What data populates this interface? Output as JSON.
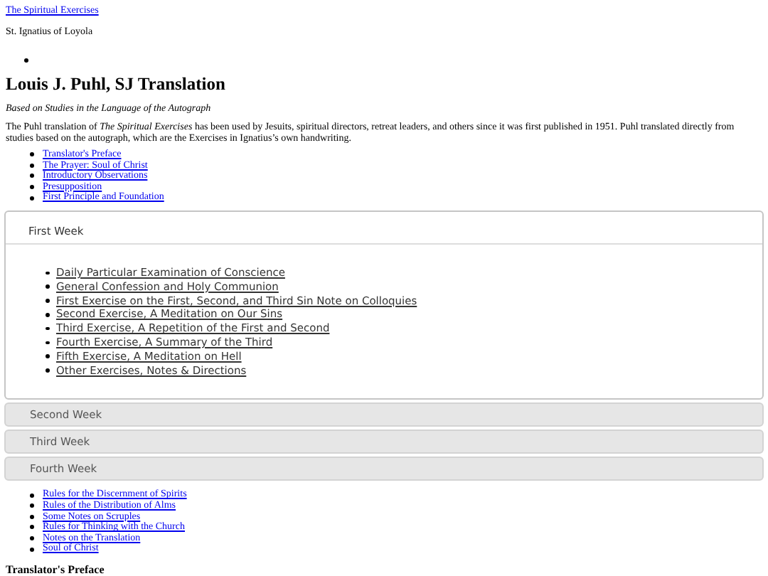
{
  "top_link": "The Spiritual Exercises",
  "author": "St. Ignatius of Loyola",
  "heading": "Louis J. Puhl, SJ Translation",
  "subtitle": "Based on Studies in the Language of the Autograph",
  "intro": "The Puhl translation of *The Spiritual Exercises* has been used by Jesuits, spiritual directors, retreat leaders, and others since it was first published in 1951. Puhl translated directly from studies based on the autograph, which are the Exercises in Ignatius’s own handwriting.",
  "contents_links": [
    "Translator's Preface",
    "The Prayer: Soul of Christ",
    "Introductory Observations",
    "Presupposition",
    "First Principle and Foundation"
  ],
  "weeks": [
    {
      "title": "First Week",
      "expanded": true,
      "items": [
        "Daily Particular Examination of Conscience",
        "General Confession and Holy Communion",
        "First Exercise on the First, Second, and Third Sin Note on Colloquies",
        "Second Exercise, A Meditation on Our Sins",
        "Third Exercise, A Repetition of the First and Second",
        "Fourth Exercise, A Summary of the Third",
        "Fifth Exercise, A Meditation on Hell",
        "Other Exercises, Notes & Directions"
      ]
    },
    {
      "title": "Second Week",
      "expanded": false
    },
    {
      "title": "Third Week",
      "expanded": false
    },
    {
      "title": "Fourth Week",
      "expanded": false
    }
  ],
  "rules_links": [
    "Rules for the Discernment of Spirits",
    "Rules of the Distribution of Alms",
    "Some Notes on Scruples",
    "Rules for Thinking with the Church",
    "Notes on the Translation",
    "Soul of Christ"
  ],
  "section_heading": "Translator's Preface"
}
